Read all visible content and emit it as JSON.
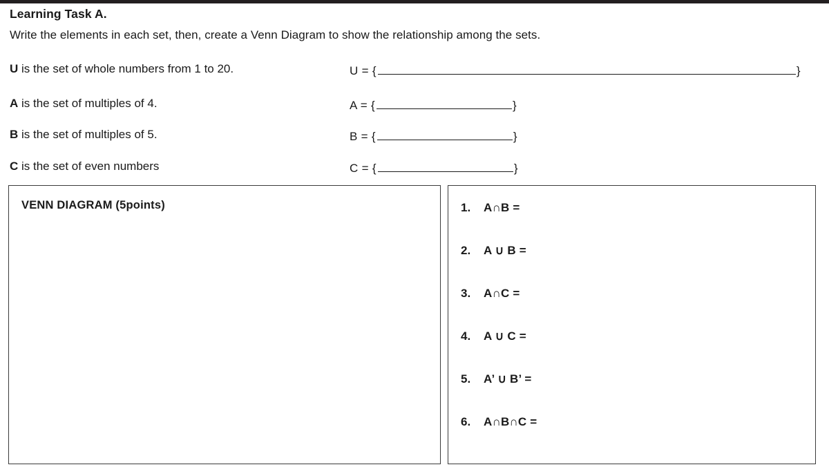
{
  "worksheet": {
    "title": "Learning Task A.",
    "instruction": "Write the elements in each set, then, create a Venn Diagram to show the relationship among the sets."
  },
  "sets": [
    {
      "letter": "U",
      "description": " is the set of whole numbers from 1 to 20.",
      "lead": "U = {",
      "close": "}"
    },
    {
      "letter": "A",
      "description": " is the set of multiples of 4.",
      "lead": "A = {",
      "close": "}"
    },
    {
      "letter": "B",
      "description": " is the set of multiples of 5.",
      "lead": "B = {",
      "close": "}"
    },
    {
      "letter": "C",
      "description": " is the set of even numbers",
      "lead": "C = {",
      "close": "}"
    }
  ],
  "venn_panel": {
    "title": "VENN DIAGRAM  (5points)"
  },
  "operations_panel": {
    "items": [
      {
        "number": "1.",
        "expression": "A∩B  ="
      },
      {
        "number": "2.",
        "expression": "A ∪ B ="
      },
      {
        "number": "3.",
        "expression": "A∩C  ="
      },
      {
        "number": "4.",
        "expression": "A ∪ C ="
      },
      {
        "number": "5.",
        "expression": "A’ ∪ B’ ="
      },
      {
        "number": "6.",
        "expression": "A∩B∩C ="
      }
    ]
  }
}
